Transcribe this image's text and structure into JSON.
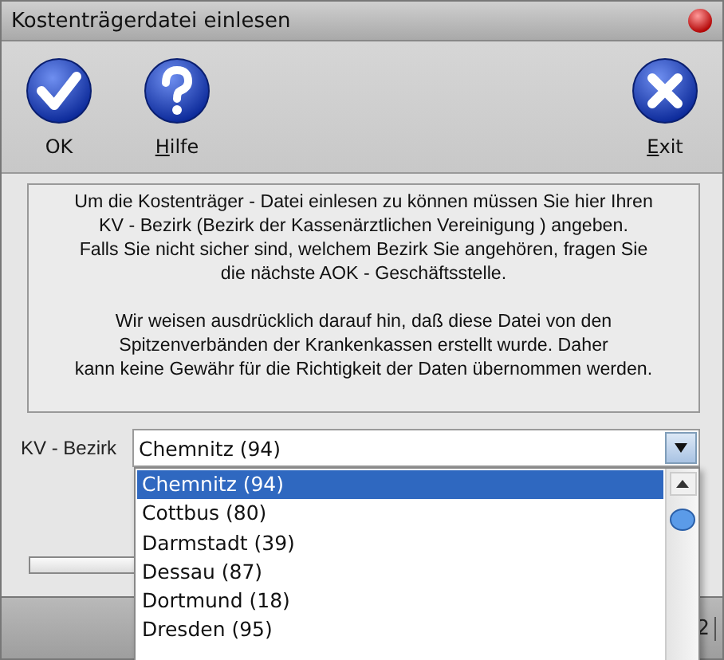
{
  "window": {
    "title": "Kostenträgerdatei einlesen"
  },
  "toolbar": [
    {
      "label": "OK",
      "kind": "ok",
      "underline_first": false
    },
    {
      "label": "Hilfe",
      "kind": "help",
      "underline_first": true
    },
    {
      "label": "Exit",
      "kind": "exit",
      "underline_first": true
    }
  ],
  "info": {
    "paragraphs": [
      "Um die Kostenträger - Datei einlesen zu können müssen Sie hier Ihren\nKV - Bezirk (Bezirk der Kassenärztlichen Vereinigung ) angeben.\nFalls Sie nicht sicher sind, welchem Bezirk Sie angehören, fragen Sie\ndie nächste AOK - Geschäftsstelle.",
      "Wir weisen ausdrücklich darauf hin, daß diese Datei von den\nSpitzenverbänden der Krankenkassen erstellt wurde. Daher\nkann keine Gewähr für die Richtigkeit der Daten übernommen werden."
    ]
  },
  "progress": {
    "level": 0
  },
  "kv_bezirk": {
    "label": "KV - Bezirk",
    "value": "Chemnitz (94)",
    "expanded": true,
    "options": [
      {
        "label": "Chemnitz (94)",
        "selected": true
      },
      {
        "label": "Cottbus (80)",
        "selected": false
      },
      {
        "label": "Darmstadt (39)",
        "selected": false
      },
      {
        "label": "Dessau (87)",
        "selected": false
      },
      {
        "label": "Dortmund (18)",
        "selected": false
      },
      {
        "label": "Dresden (95)",
        "selected": false
      }
    ]
  },
  "status_bar": {
    "text": "2"
  }
}
